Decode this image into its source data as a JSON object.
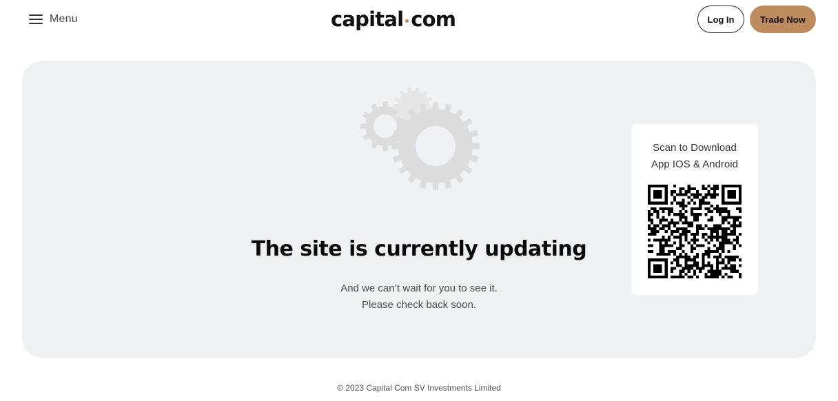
{
  "header": {
    "menu_label": "Menu",
    "logo_left": "capital",
    "logo_right": "com",
    "login_label": "Log In",
    "trade_label": "Trade Now"
  },
  "main": {
    "headline": "The site is currently updating",
    "line1": "And we can’t wait for you to see it.",
    "line2": "Please check back soon."
  },
  "qr_card": {
    "line1": "Scan to Download",
    "line2": "App IOS & Android"
  },
  "footer": {
    "copyright": "© 2023 Capital Com SV Investments Limited"
  },
  "colors": {
    "brand_accent": "#be8b5f",
    "panel_bg": "#f0f1f2",
    "gear": "#dcdcdc"
  },
  "icons": {
    "menu": "hamburger-icon",
    "status": "gears-icon",
    "app": "qr-code"
  }
}
